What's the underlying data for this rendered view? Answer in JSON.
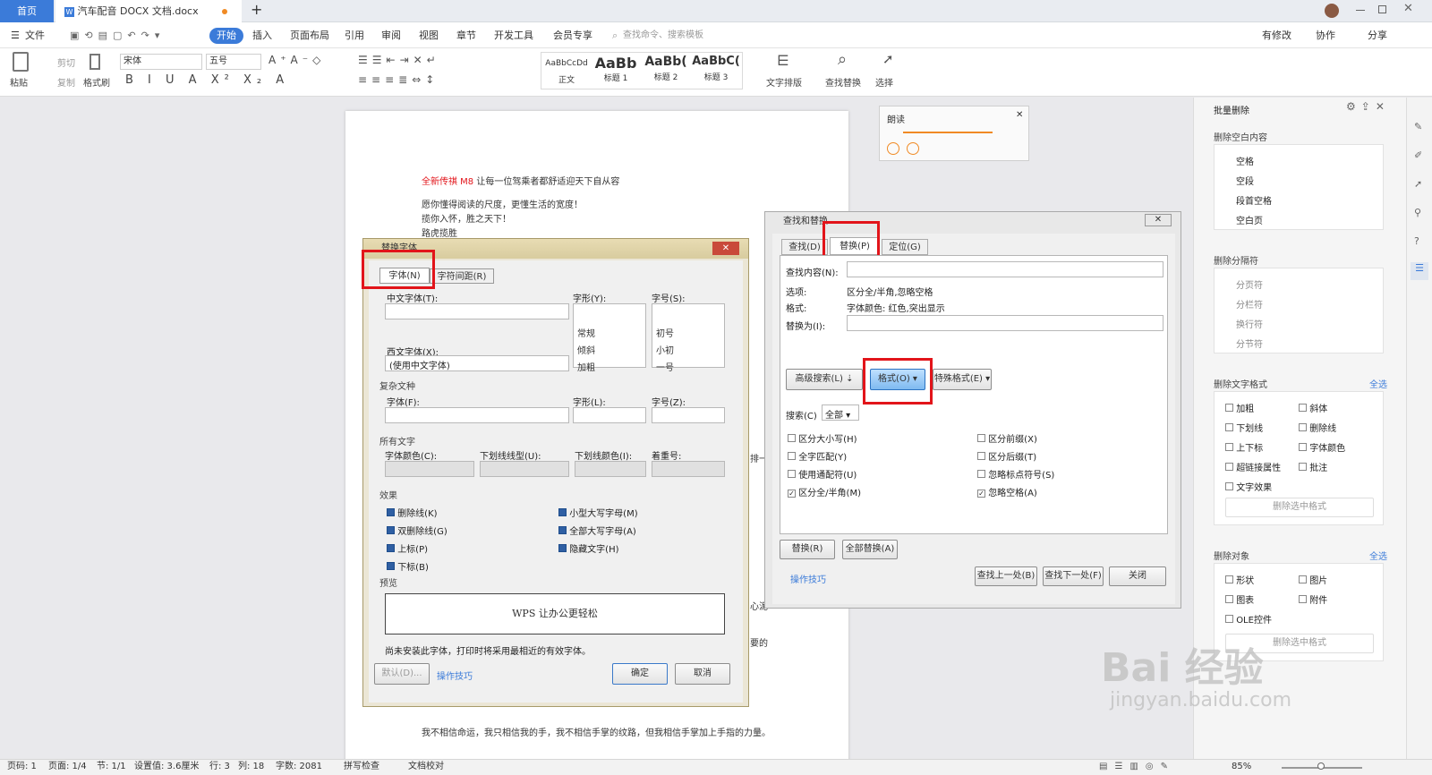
{
  "tabs": {
    "home": "首页",
    "doc": "汽车配音 DOCX 文档.docx",
    "add": "+"
  },
  "menu": {
    "file": "文件",
    "start": "开始",
    "items": [
      "插入",
      "页面布局",
      "引用",
      "审阅",
      "视图",
      "章节",
      "开发工具",
      "会员专享"
    ],
    "search": "查找命令、搜索模板",
    "right": [
      "有修改",
      "协作",
      "分享"
    ]
  },
  "ribbon": {
    "paste": "粘贴",
    "cut": "剪切",
    "copy": "复制",
    "format_painter": "格式刷",
    "font": "宋体",
    "size": "五号",
    "styles": [
      {
        "sample": "AaBbCcDd",
        "name": "正文"
      },
      {
        "sample": "AaBb",
        "name": "标题 1"
      },
      {
        "sample": "AaBb(",
        "name": "标题 2"
      },
      {
        "sample": "AaBbC(",
        "name": "标题 3"
      }
    ],
    "text_layout": "文字排版",
    "find_replace": "查找替换",
    "select": "选择"
  },
  "page": {
    "line1_red": "全新传祺 M8",
    "line1_rest": " 让每一位驾乘者都舒适迎天下自从容",
    "line2": "愿你懂得阅读的尺度，更懂生活的宽度！",
    "line3": "揽你入怀，胜之天下！",
    "line4": "路虎揽胜",
    "bottom": "我不相信命运，我只相信我的手，我不相信手掌的纹路，但我相信手掌加上手指的力量。",
    "frag1": "排一",
    "frag2": "心泥",
    "frag3": "要的"
  },
  "reader": {
    "title": "朗读"
  },
  "font_dlg": {
    "title": "替换字体",
    "tab_font": "字体(N)",
    "tab_spacing": "字符间距(R)",
    "cn_font_label": "中文字体(T):",
    "style_label": "字形(Y):",
    "size_label": "字号(S):",
    "style_opts": [
      "常规",
      "倾斜",
      "加粗"
    ],
    "size_opts": [
      "初号",
      "小初",
      "一号"
    ],
    "west_label": "西文字体(X):",
    "west_value": "(使用中文字体)",
    "complex": "复杂文种",
    "font_label": "字体(F):",
    "style2": "字形(L):",
    "size2": "字号(Z):",
    "all_text": "所有文字",
    "color_label": "字体颜色(C):",
    "underline_label": "下划线线型(U):",
    "ucolor_label": "下划线颜色(I):",
    "emphasis_label": "着重号:",
    "effects": "效果",
    "eff_left": [
      "删除线(K)",
      "双删除线(G)",
      "上标(P)",
      "下标(B)"
    ],
    "eff_right": [
      "小型大写字母(M)",
      "全部大写字母(A)",
      "隐藏文字(H)"
    ],
    "preview": "预览",
    "preview_text": "WPS 让办公更轻松",
    "note": "尚未安装此字体，打印时将采用最相近的有效字体。",
    "default_btn": "默认(D)...",
    "tips": "操作技巧",
    "ok": "确定",
    "cancel": "取消"
  },
  "find_dlg": {
    "title": "查找和替换",
    "tab_find": "查找(D)",
    "tab_replace": "替换(P)",
    "tab_goto": "定位(G)",
    "find_label": "查找内容(N):",
    "options_label": "选项:",
    "options_value": "区分全/半角,忽略空格",
    "format_label": "格式:",
    "format_value": "字体颜色: 红色,突出显示",
    "replace_label": "替换为(I):",
    "advanced": "高级搜索(L) ⇣",
    "format_btn": "格式(O)",
    "special": "特殊格式(E)",
    "search_label": "搜索(C)",
    "search_value": "全部",
    "left_opts": [
      {
        "label": "区分大小写(H)",
        "checked": false
      },
      {
        "label": "全字匹配(Y)",
        "checked": false
      },
      {
        "label": "使用通配符(U)",
        "checked": false
      },
      {
        "label": "区分全/半角(M)",
        "checked": true
      }
    ],
    "right_opts": [
      {
        "label": "区分前缀(X)",
        "checked": false
      },
      {
        "label": "区分后缀(T)",
        "checked": false
      },
      {
        "label": "忽略标点符号(S)",
        "checked": false
      },
      {
        "label": "忽略空格(A)",
        "checked": true
      }
    ],
    "replace_btn": "替换(R)",
    "replace_all": "全部替换(A)",
    "tips": "操作技巧",
    "prev": "查找上一处(B)",
    "next": "查找下一处(F)",
    "close": "关闭"
  },
  "panel": {
    "title": "批量删除",
    "s1": "删除空白内容",
    "s1_items": [
      "空格",
      "空段",
      "段首空格",
      "空白页"
    ],
    "s2": "删除分隔符",
    "s2_items": [
      "分页符",
      "分栏符",
      "换行符",
      "分节符"
    ],
    "s3": "删除文字格式",
    "select_all": "全选",
    "s3_items": [
      "加粗",
      "斜体",
      "下划线",
      "删除线",
      "上下标",
      "字体颜色",
      "超链接属性",
      "批注",
      "文字效果"
    ],
    "del_fmt": "删除选中格式",
    "s4": "删除对象",
    "s4_items": [
      "形状",
      "图片",
      "图表",
      "附件",
      "OLE控件"
    ],
    "del_sel": "删除选中格式"
  },
  "status": {
    "items": [
      "页码: 1",
      "页面: 1/4",
      "节: 1/1",
      "设置值: 3.6厘米",
      "行: 3",
      "列: 18",
      "字数: 2081",
      "拼写检查",
      "文档校对"
    ],
    "zoom": "85%"
  },
  "watermark": {
    "line1": "Bai 经验",
    "line2": "jingyan.baidu.com"
  }
}
